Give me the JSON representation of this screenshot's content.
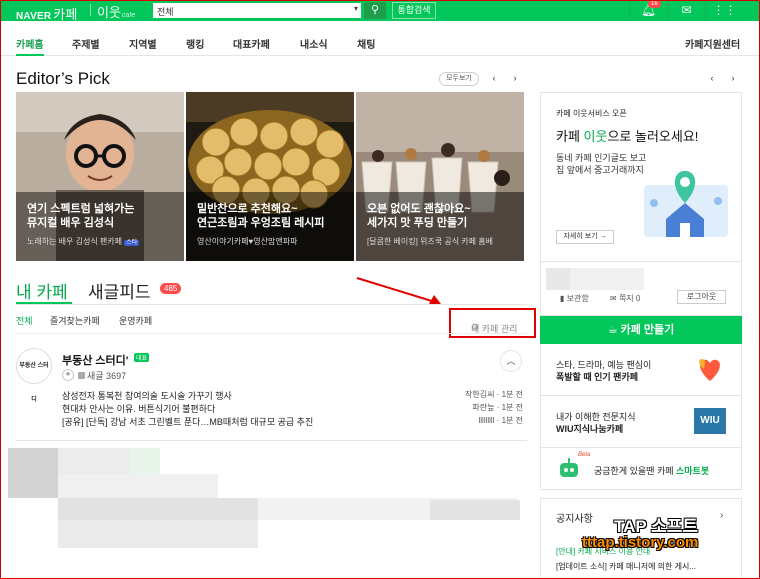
{
  "top": {
    "logo_brand": "NAVER",
    "logo_cafe": "카페",
    "service": "이웃",
    "service_sub": "cafe",
    "search_scope": "전체",
    "search_placeholder": "",
    "search_button": "통합검색",
    "notification_count": "16",
    "brand_color": "#03c75a"
  },
  "nav": {
    "items": [
      "카페홈",
      "주제별",
      "지역별",
      "랭킹",
      "대표카페",
      "내소식",
      "채팅"
    ],
    "right": "카페지원센터"
  },
  "editors_pick": {
    "title": "Editor’s Pick",
    "more": "모두보기",
    "cards": [
      {
        "caption1": "연기 스펙트럼 넓혀가는",
        "caption2": "뮤지컬 배우 김성식",
        "sub": "노래하는 배우 김성식 팬카페",
        "tag": "스타"
      },
      {
        "caption1": "밑반찬으로 추천해요~",
        "caption2": "연근조림과 우엉조림 레시피",
        "sub": "영산이야기카페♥영산맘앤파파"
      },
      {
        "caption1": "오븐 없어도 괜찮아요~",
        "caption2": "세가지 맛 푸딩 만들기",
        "sub": "[달콤한 베이킹] 위즈쿡 공식 카페 홈베"
      }
    ]
  },
  "my_cafe": {
    "tab_my": "내 카페",
    "tab_feed": "새글피드",
    "feed_count": "485",
    "filters": [
      "전체",
      "즐겨찾는카페",
      "운영카페"
    ],
    "manage": "내 카페 관리",
    "cafe": {
      "logo_text": "부동산 스터디",
      "name": "부동산 스터디'",
      "badge": "대표",
      "new_label": "새글 3697",
      "posts": [
        {
          "title": "삼성전자 통복천 참여의술 도시술 가꾸기 행사",
          "author": "작한김씨",
          "time": "1분 전"
        },
        {
          "title": "현대차 안사는 이유. 버튼식기어 불편하다",
          "author": "파란늪",
          "time": "1분 전"
        },
        {
          "title": "[공유] [단독] 강남 서초 그린벨트 푼다…MB때처럼 대규모 공급 추진",
          "author": "lllllllll",
          "time": "1분 전"
        }
      ]
    }
  },
  "right": {
    "promo_small": "카페 이웃서비스 오픈",
    "promo_big_pre": "카페 ",
    "promo_big_em": "이웃",
    "promo_big_post": "으로 놀러오세요!",
    "promo_desc1": "동네 카페 인기글도 보고",
    "promo_desc2": "집 앞에서 중고거래까지",
    "promo_btn": "자세히 보기 →",
    "mine": "보관함",
    "note": "쪽지",
    "note_count": "0",
    "logout": "로그아웃",
    "make_cafe": "카페 만들기",
    "promo_items": [
      {
        "line1": "스타, 드라마, 예능 팬심이",
        "line2": "폭발할 때 인기 팬카페"
      },
      {
        "line1": "내가 이해한 전문지식",
        "line2": "WIU지식나눔카페"
      },
      {
        "line1": "궁금한게 있을땐 카페 ",
        "line2": "스마트봇"
      }
    ],
    "bot_tag": "Beta",
    "wiu_label": "WIU",
    "notice_title": "공지사항",
    "notices": [
      "[안내] 카페 서비스 이용 안내",
      "[업데이트 소식] 카페 매니저에 의한 게시..."
    ]
  },
  "watermark": {
    "line1": "TAP 소프트",
    "line2": "tttap.tistory.com"
  }
}
